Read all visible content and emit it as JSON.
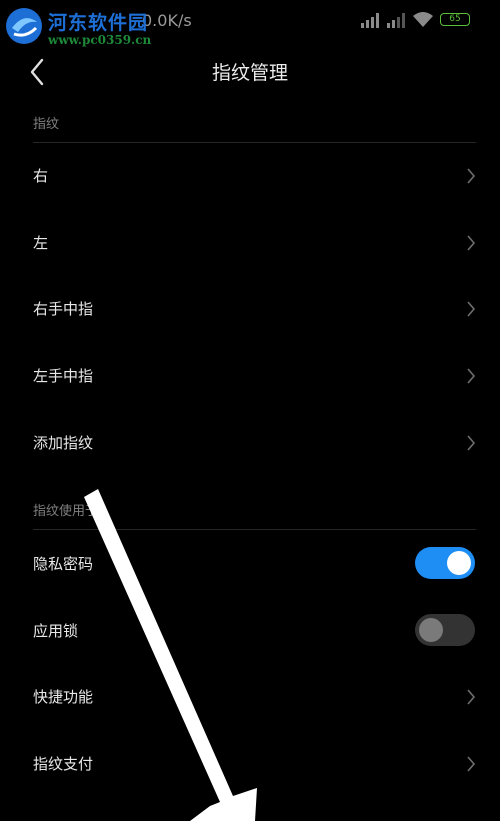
{
  "status_bar": {
    "network_speed": "0.0K/s",
    "battery_level": "65",
    "icons": [
      "signal-icon",
      "signal-icon",
      "wifi-icon",
      "battery-icon"
    ],
    "battery_color": "#5bbf3a"
  },
  "watermark": {
    "title": "河东软件园",
    "url": "www.pc0359.cn"
  },
  "header": {
    "title": "指纹管理",
    "back_icon": "chevron-left-icon"
  },
  "fingerprints_section": {
    "label": "指纹",
    "items": [
      {
        "label": "右"
      },
      {
        "label": "左"
      },
      {
        "label": "右手中指"
      },
      {
        "label": "左手中指"
      },
      {
        "label": "添加指纹"
      }
    ]
  },
  "usage_section": {
    "label": "指纹使用于",
    "items": [
      {
        "label": "隐私密码",
        "control": "toggle",
        "enabled": true
      },
      {
        "label": "应用锁",
        "control": "toggle",
        "enabled": false
      },
      {
        "label": "快捷功能",
        "control": "chevron"
      },
      {
        "label": "指纹支付",
        "control": "chevron"
      }
    ]
  },
  "colors": {
    "background": "#000000",
    "accent": "#1e8ef5",
    "text": "#e8e8e8",
    "muted": "#808080"
  }
}
